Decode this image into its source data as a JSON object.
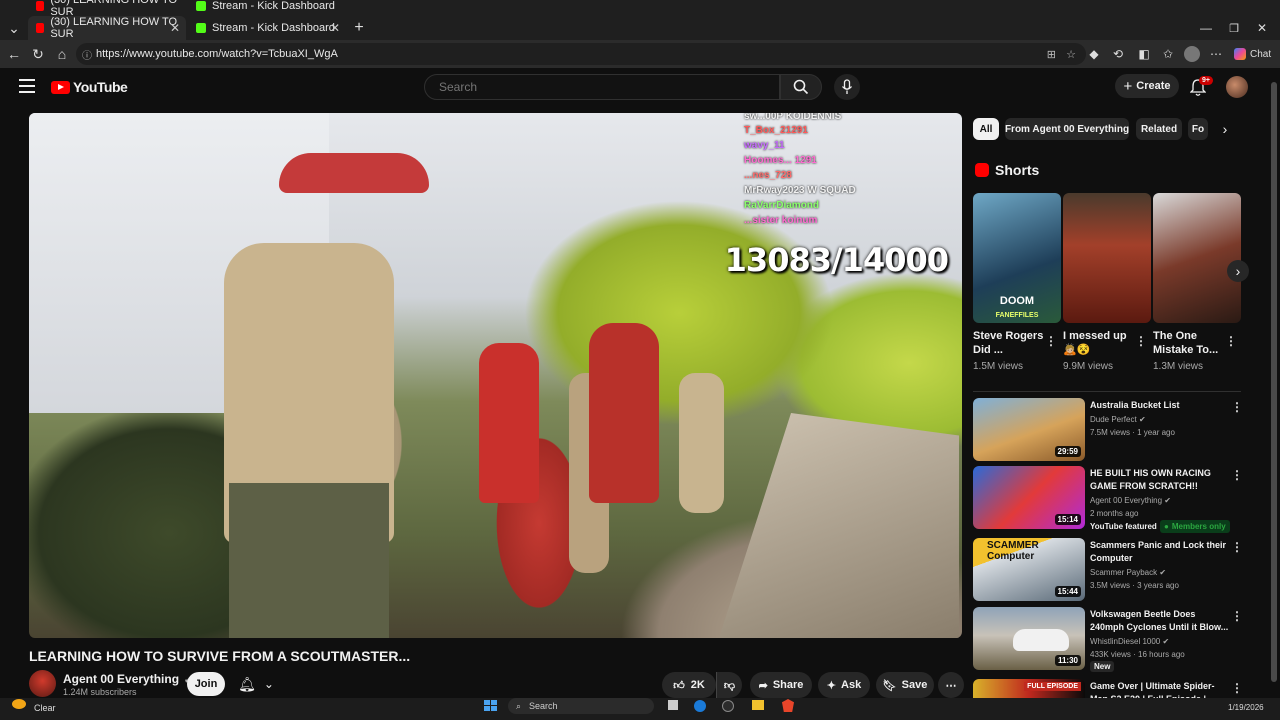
{
  "browser": {
    "ghost_tabs": [
      "(30) LEARNING HOW TO SUR",
      "Stream - Kick Dashboard"
    ],
    "tabs": [
      {
        "label": "(30) LEARNING HOW TO SUR",
        "favicon_color": "#ff0000",
        "active": true
      },
      {
        "label": "Stream - Kick Dashboard",
        "favicon_color": "#53fc18",
        "active": false
      }
    ],
    "new_tab": "+",
    "url": "https://www.youtube.com/watch?v=TcbuaXI_WgA",
    "chat_label": "Chat"
  },
  "youtube": {
    "logo_text": "YouTube",
    "search_placeholder": "Search",
    "create_label": "Create",
    "notification_count": "9+"
  },
  "video": {
    "title": "LEARNING HOW TO SURVIVE FROM A SCOUTMASTER...",
    "overlay_counter": "13083/14000",
    "chat_lines": [
      {
        "text": "sw...00P  KOIDENNIS",
        "color": "#ffffff"
      },
      {
        "text": "T_Box_21291",
        "color": "#ff5b5b"
      },
      {
        "text": "wavy_11",
        "color": "#c66bff"
      },
      {
        "text": "Hoomes... 1291",
        "color": "#ff6bd1"
      },
      {
        "text": "...nes_728",
        "color": "#ff6b6b"
      },
      {
        "text": "MrRway2023  W SQUAD",
        "color": "#ffffff"
      },
      {
        "text": "RaVarrDiamond",
        "color": "#8aff6b"
      },
      {
        "text": "...sister  koinum",
        "color": "#ff6bd1"
      }
    ]
  },
  "channel": {
    "name": "Agent 00 Everything",
    "subscribers": "1.24M subscribers",
    "join_label": "Join"
  },
  "actions": {
    "likes": "2K",
    "share": "Share",
    "ask": "Ask",
    "save": "Save"
  },
  "chips": [
    "All",
    "From Agent 00 Everything",
    "Related",
    "Fo"
  ],
  "shorts": {
    "heading": "Shorts",
    "items": [
      {
        "title": "Steve Rogers Did ...",
        "views": "1.5M views",
        "overlay": "DOOM",
        "overlay_sub": "FANEFFILES"
      },
      {
        "title": "I messed up 🙇🏼😵",
        "views": "9.9M views"
      },
      {
        "title": "The One Mistake To...",
        "views": "1.3M views"
      }
    ]
  },
  "recommended": [
    {
      "title": "Australia Bucket List",
      "channel": "Dude Perfect",
      "verified": true,
      "meta": "7.5M views · 1 year ago",
      "duration": "29:59"
    },
    {
      "title": "HE BUILT HIS OWN RACING GAME FROM SCRATCH!!",
      "channel": "Agent 00 Everything",
      "verified": true,
      "meta": "2 months ago",
      "duration": "15:14",
      "badge1": "YouTube featured",
      "badge2": "Members only"
    },
    {
      "title": "Scammers Panic and Lock their Computer",
      "channel": "Scammer Payback",
      "verified": true,
      "meta": "3.5M views · 3 years ago",
      "duration": "15:44",
      "thumb_text": "SCAMMER Computer"
    },
    {
      "title": "Volkswagen Beetle Does 240mph Cyclones Until it Blow...",
      "channel": "WhistlinDiesel 1000",
      "verified": true,
      "meta": "433K views · 16 hours ago",
      "duration": "11:30",
      "badge1": "New"
    },
    {
      "title": "Game Over | Ultimate Spider-Man S2 E20 | Full Episode |",
      "thumb_text": "FULL EPISODE"
    }
  ],
  "taskbar": {
    "weather": "Clear",
    "search": "Search",
    "date": "1/19/2026"
  }
}
